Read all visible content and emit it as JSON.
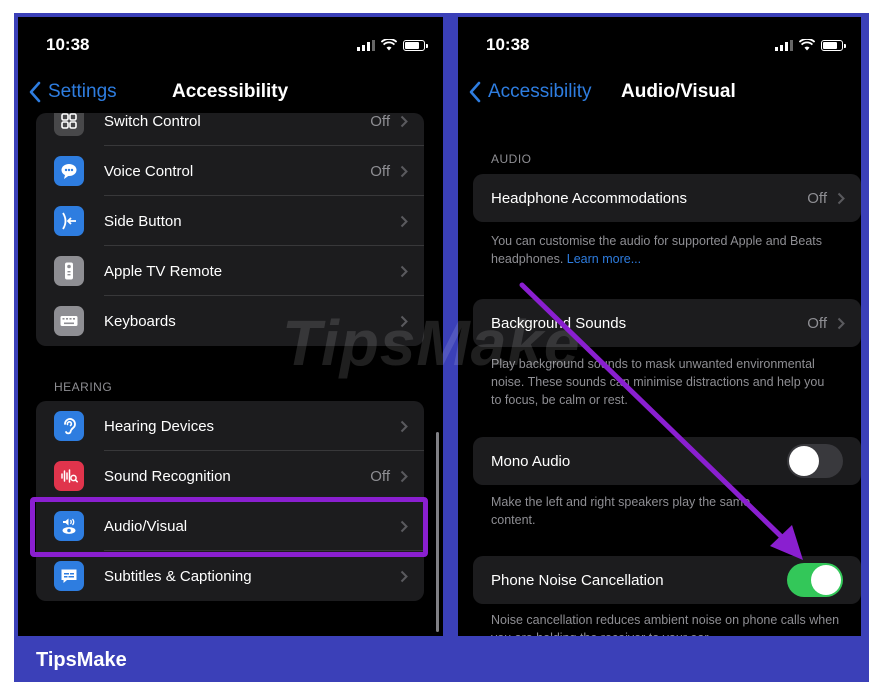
{
  "left": {
    "time": "10:38",
    "back_label": "Settings",
    "title": "Accessibility",
    "group1": [
      {
        "label": "Switch Control",
        "value": "Off",
        "icon": "switch-control-icon",
        "color": "#48484a"
      },
      {
        "label": "Voice Control",
        "value": "Off",
        "icon": "voice-control-icon",
        "color": "#2e7de0"
      },
      {
        "label": "Side Button",
        "value": "",
        "icon": "side-button-icon",
        "color": "#2e7de0"
      },
      {
        "label": "Apple TV Remote",
        "value": "",
        "icon": "tv-remote-icon",
        "color": "#8e8e93"
      },
      {
        "label": "Keyboards",
        "value": "",
        "icon": "keyboard-icon",
        "color": "#8e8e93"
      }
    ],
    "hearing_header": "HEARING",
    "group2": [
      {
        "label": "Hearing Devices",
        "value": "",
        "icon": "ear-icon",
        "color": "#2e7de0"
      },
      {
        "label": "Sound Recognition",
        "value": "Off",
        "icon": "sound-recognition-icon",
        "color": "#e0344c"
      },
      {
        "label": "Audio/Visual",
        "value": "",
        "icon": "audio-visual-icon",
        "color": "#2e7de0"
      },
      {
        "label": "Subtitles & Captioning",
        "value": "",
        "icon": "captions-icon",
        "color": "#2e7de0"
      }
    ]
  },
  "right": {
    "time": "10:38",
    "back_label": "Accessibility",
    "title": "Audio/Visual",
    "audio_header": "AUDIO",
    "headphone": {
      "label": "Headphone Accommodations",
      "value": "Off"
    },
    "headphone_footer": "You can customise the audio for supported Apple and Beats headphones.",
    "headphone_link": "Learn more...",
    "background": {
      "label": "Background Sounds",
      "value": "Off"
    },
    "background_footer": "Play background sounds to mask unwanted environmental noise. These sounds can minimise distractions and help you to focus, be calm or rest.",
    "mono": {
      "label": "Mono Audio",
      "on": false
    },
    "mono_footer": "Make the left and right speakers play the same content.",
    "noise": {
      "label": "Phone Noise Cancellation",
      "on": true
    },
    "noise_footer": "Noise cancellation reduces ambient noise on phone calls when you are holding the receiver to your ear."
  },
  "watermark": "TipsMake",
  "brand": "TipsMake",
  "colors": {
    "frame": "#3b40b8",
    "highlight": "#8a1fd0",
    "toggle_on": "#33c759",
    "link": "#2e7de0"
  }
}
